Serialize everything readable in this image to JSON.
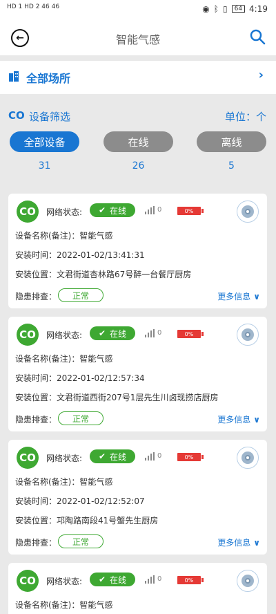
{
  "status_bar": {
    "left": "HD 1 HD 2 46 46",
    "battery": "64",
    "time": "4:19"
  },
  "header": {
    "title": "智能气感"
  },
  "place": {
    "label": "全部场所"
  },
  "filter": {
    "co": "CO",
    "title": "设备筛选",
    "unit": "单位：个",
    "segments": [
      {
        "label": "全部设备",
        "count": "31"
      },
      {
        "label": "在线",
        "count": "26"
      },
      {
        "label": "离线",
        "count": "5"
      }
    ]
  },
  "labels": {
    "co": "CO",
    "net": "网络状态:",
    "online": "在线",
    "signal": "0",
    "battery": "0%",
    "name": "设备名称(备注)：",
    "time": "安装时间：",
    "location": "安装位置：",
    "hazard": "隐患排查：",
    "hazard_status": "正常",
    "more": "更多信息"
  },
  "devices": [
    {
      "name": "智能气感",
      "time": "2022-01-02/13:41:31",
      "location": "文君街道杏林路67号醉一台餐厅厨房"
    },
    {
      "name": "智能气感",
      "time": "2022-01-02/12:57:34",
      "location": "文君街道西街207号1层先生川卤现捞店厨房"
    },
    {
      "name": "智能气感",
      "time": "2022-01-02/12:52:07",
      "location": "邛陶路南段41号蟹先生厨房"
    },
    {
      "name": "智能气感"
    }
  ],
  "colors": {
    "accent": "#1976d2",
    "online": "#3ea832",
    "battery_low": "#e53935"
  }
}
